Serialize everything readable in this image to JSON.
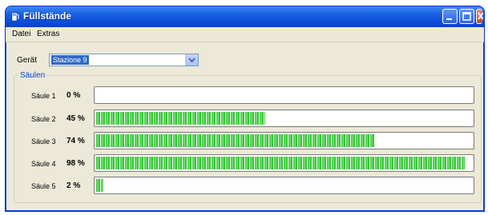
{
  "window": {
    "title": "Füllstände",
    "icon": "gas-pump-icon"
  },
  "menu": [
    "Datei",
    "Extras"
  ],
  "device": {
    "label": "Gerät",
    "value": "Stazione 9"
  },
  "group_title": "Säulen",
  "columns": [
    {
      "label": "Säule 1",
      "value": "0 %",
      "percent": 0
    },
    {
      "label": "Säule 2",
      "value": "45 %",
      "percent": 45
    },
    {
      "label": "Säule 3",
      "value": "74 %",
      "percent": 74
    },
    {
      "label": "Säule 4",
      "value": "98 %",
      "percent": 98
    },
    {
      "label": "Säule 5",
      "value": "2 %",
      "percent": 2
    }
  ],
  "colors": {
    "titlebar": "#0b4fdc",
    "fill": "#2fc02f",
    "selection": "#316ac5"
  }
}
